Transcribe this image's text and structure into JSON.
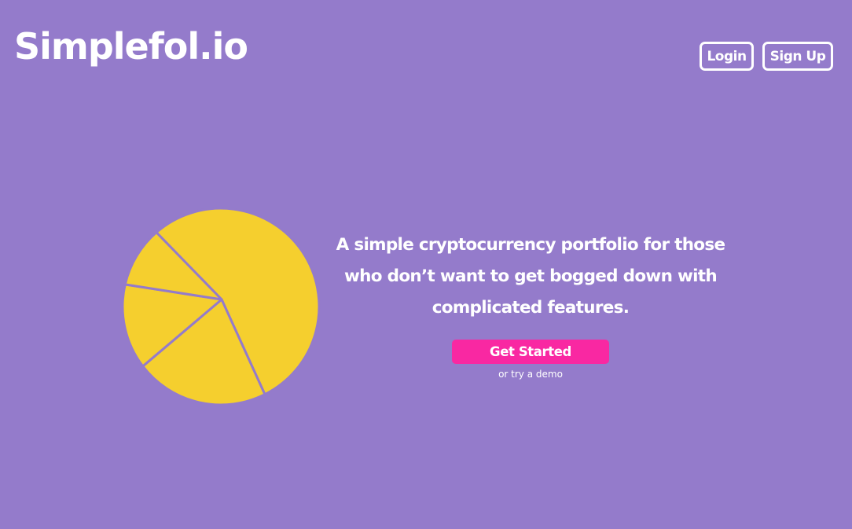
{
  "header": {
    "brand": "Simplefol.io",
    "login_label": "Login",
    "signup_label": "Sign Up"
  },
  "hero": {
    "tagline": "A simple cryptocurrency portfolio for those who don’t want to get bogged down with complicated features.",
    "cta_label": "Get Started",
    "demo_label": "or try a demo"
  },
  "illustration": {
    "pie_slices": [
      0.54,
      0.22,
      0.14,
      0.1
    ],
    "slice_color": "#f5cf2e",
    "divider_color": "#947bcb"
  },
  "colors": {
    "background": "#947bcb",
    "accent": "#f928a2",
    "text": "#ffffff"
  }
}
